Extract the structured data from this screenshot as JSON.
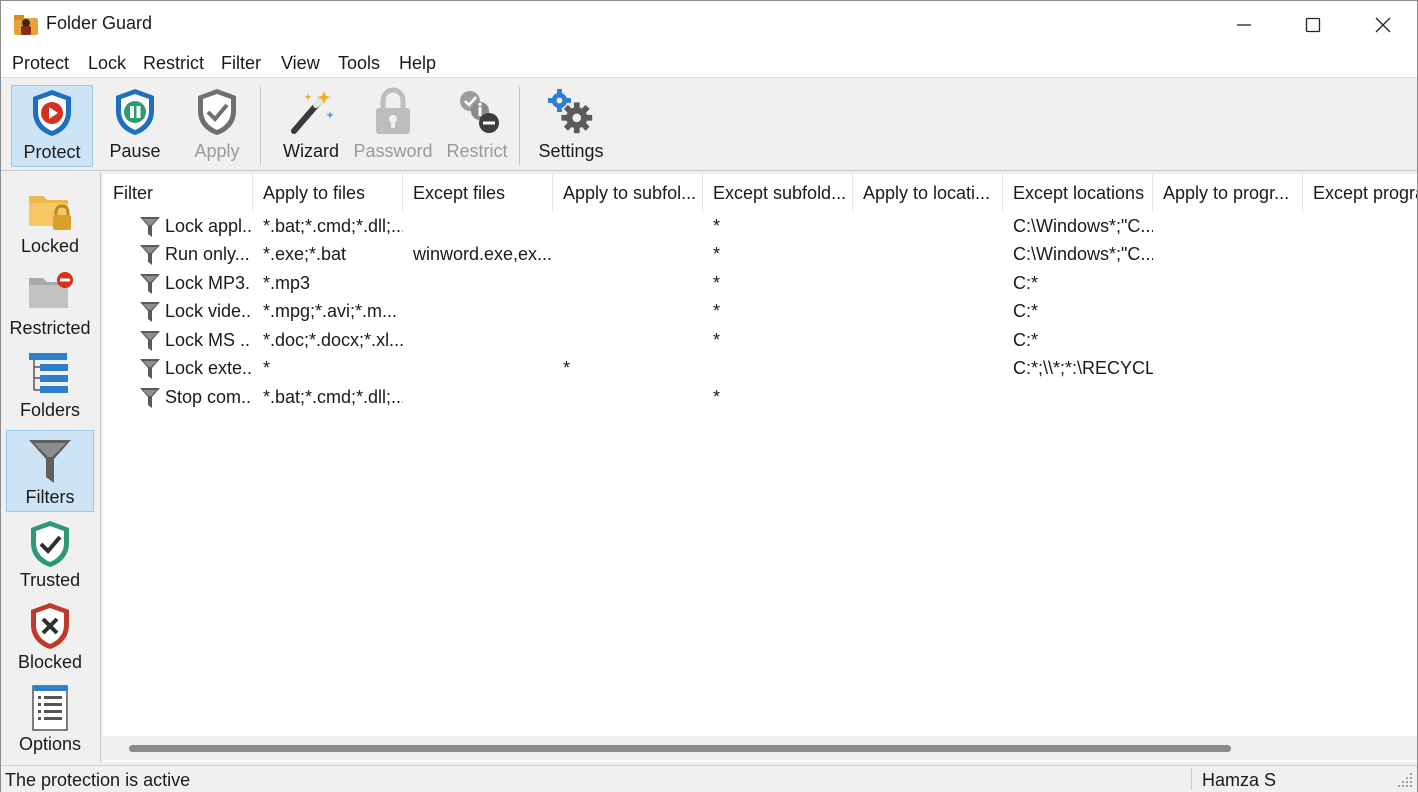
{
  "window": {
    "title": "Folder Guard"
  },
  "menu": [
    "Protect",
    "Lock",
    "Restrict",
    "Filter",
    "View",
    "Tools",
    "Help"
  ],
  "toolbar": {
    "protect": "Protect",
    "pause": "Pause",
    "apply": "Apply",
    "wizard": "Wizard",
    "password": "Password",
    "restrict": "Restrict",
    "settings": "Settings"
  },
  "nav": {
    "locked": "Locked",
    "restricted": "Restricted",
    "folders": "Folders",
    "filters": "Filters",
    "trusted": "Trusted",
    "blocked": "Blocked",
    "options": "Options"
  },
  "table": {
    "columns": [
      "Filter",
      "Apply to files",
      "Except files",
      "Apply to subfol...",
      "Except subfold...",
      "Apply to locati...",
      "Except locations",
      "Apply to progr...",
      "Except progra"
    ],
    "rows": [
      [
        "Lock appl...",
        "*.bat;*.cmd;*.dll;...",
        "",
        "",
        "*",
        "",
        "C:\\Windows*;\"C...",
        "",
        ""
      ],
      [
        "Run only...",
        "*.exe;*.bat",
        "winword.exe,ex...",
        "",
        "*",
        "",
        "C:\\Windows*;\"C...",
        "",
        ""
      ],
      [
        "Lock MP3...",
        "*.mp3",
        "",
        "",
        "*",
        "",
        "C:*",
        "",
        ""
      ],
      [
        "Lock vide...",
        "*.mpg;*.avi;*.m...",
        "",
        "",
        "*",
        "",
        "C:*",
        "",
        ""
      ],
      [
        "Lock MS ...",
        "*.doc;*.docx;*.xl...",
        "",
        "",
        "*",
        "",
        "C:*",
        "",
        ""
      ],
      [
        "Lock exte...",
        "*",
        "",
        "*",
        "",
        "",
        "C:*;\\\\*;*:\\RECYCL...",
        "",
        ""
      ],
      [
        "Stop com...",
        "*.bat;*.cmd;*.dll;...",
        "",
        "",
        "*",
        "",
        "",
        "",
        ""
      ]
    ]
  },
  "status": {
    "message": "The protection is active",
    "user": "Hamza S"
  },
  "colors": {
    "accent": "#1e6fbf",
    "selected": "#cde4f7",
    "trusted": "#2e9a74",
    "blocked": "#c0392b"
  }
}
